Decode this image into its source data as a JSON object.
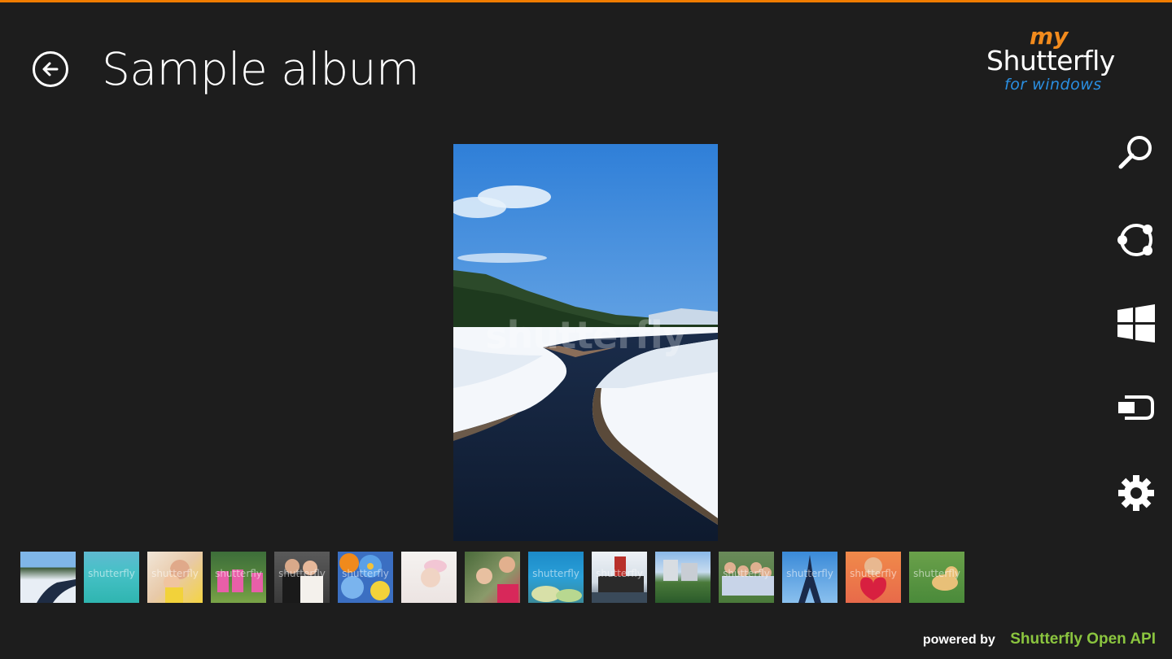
{
  "header": {
    "title": "Sample album",
    "back_icon": "back-arrow-icon"
  },
  "logo": {
    "my": "my",
    "brand": "Shutterfly",
    "platform": "for windows"
  },
  "charms": [
    {
      "name": "search",
      "icon": "search-icon"
    },
    {
      "name": "share",
      "icon": "share-icon"
    },
    {
      "name": "start",
      "icon": "windows-start-icon"
    },
    {
      "name": "devices",
      "icon": "devices-icon"
    },
    {
      "name": "settings",
      "icon": "gear-icon"
    }
  ],
  "main_photo": {
    "watermark": "shutterfly"
  },
  "thumbnails": [
    {
      "subject": "snowy creek",
      "watermark": ""
    },
    {
      "subject": "turquoise sea",
      "watermark": "shutterfly"
    },
    {
      "subject": "mother and child",
      "watermark": "shutterfly"
    },
    {
      "subject": "girls in pink",
      "watermark": "shutterfly"
    },
    {
      "subject": "wedding couple",
      "watermark": "shutterfly"
    },
    {
      "subject": "blue flowers",
      "watermark": "shutterfly"
    },
    {
      "subject": "sleeping baby",
      "watermark": ""
    },
    {
      "subject": "family on blanket",
      "watermark": ""
    },
    {
      "subject": "coral reef",
      "watermark": "shutterfly"
    },
    {
      "subject": "tugboat",
      "watermark": "shutterfly"
    },
    {
      "subject": "city park",
      "watermark": ""
    },
    {
      "subject": "group photo",
      "watermark": "shutterfly"
    },
    {
      "subject": "eiffel tower",
      "watermark": "shutterfly"
    },
    {
      "subject": "girl with heart",
      "watermark": "shutterfly"
    },
    {
      "subject": "dog on grass",
      "watermark": "shutterfly"
    }
  ],
  "footer": {
    "powered_by": "powered by",
    "api": "Shutterfly Open API"
  },
  "colors": {
    "background": "#1d1d1d",
    "accent_bar": "#f07c00",
    "logo_my": "#f28b1d",
    "logo_sub": "#2a8ee0",
    "api_green": "#8bc53f"
  }
}
